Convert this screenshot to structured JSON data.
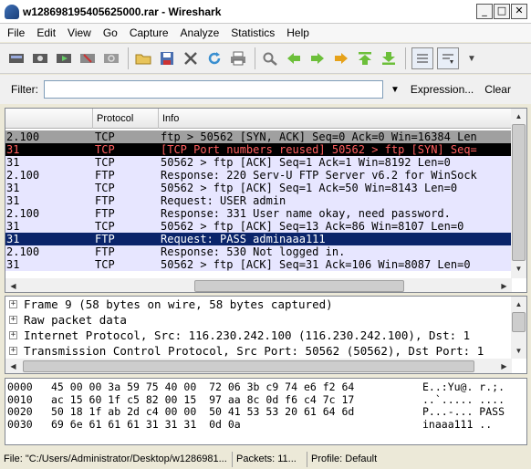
{
  "window": {
    "title": "w128698195405625000.rar - Wireshark",
    "min": "_",
    "max": "□",
    "close": "✕"
  },
  "menu": [
    "File",
    "Edit",
    "View",
    "Go",
    "Capture",
    "Analyze",
    "Statistics",
    "Help"
  ],
  "filter": {
    "label": "Filter:",
    "value": "",
    "expression": "Expression...",
    "clear": "Clear"
  },
  "packet_list": {
    "columns": [
      "",
      "Protocol",
      "Info"
    ],
    "rows": [
      {
        "c1": "2.100",
        "proto": "TCP",
        "info": "ftp > 50562 [SYN, ACK] Seq=0 Ack=0 Win=16384 Len",
        "bg": "#a0a0a0",
        "fg": "#000000"
      },
      {
        "c1": "31",
        "proto": "TCP",
        "info": "[TCP Port numbers reused] 50562 > ftp [SYN] Seq=",
        "bg": "#000000",
        "fg": "#ff5f5f"
      },
      {
        "c1": "31",
        "proto": "TCP",
        "info": "50562 > ftp [ACK] Seq=1 Ack=1 Win=8192 Len=0",
        "bg": "#e7e6ff",
        "fg": "#000000"
      },
      {
        "c1": "2.100",
        "proto": "FTP",
        "info": "Response: 220 Serv-U FTP Server v6.2 for WinSock",
        "bg": "#e7e6ff",
        "fg": "#000000"
      },
      {
        "c1": "31",
        "proto": "TCP",
        "info": "50562 > ftp [ACK] Seq=1 Ack=50 Win=8143 Len=0",
        "bg": "#e7e6ff",
        "fg": "#000000"
      },
      {
        "c1": "31",
        "proto": "FTP",
        "info": "Request: USER admin",
        "bg": "#e7e6ff",
        "fg": "#000000"
      },
      {
        "c1": "2.100",
        "proto": "FTP",
        "info": "Response: 331 User name okay, need password.",
        "bg": "#e7e6ff",
        "fg": "#000000"
      },
      {
        "c1": "31",
        "proto": "TCP",
        "info": "50562 > ftp [ACK] Seq=13 Ack=86 Win=8107 Len=0",
        "bg": "#e7e6ff",
        "fg": "#000000"
      },
      {
        "c1": "31",
        "proto": "FTP",
        "info": "Request: PASS adminaaa111",
        "bg": "#0a246a",
        "fg": "#ffffff"
      },
      {
        "c1": "2.100",
        "proto": "FTP",
        "info": "Response: 530 Not logged in.",
        "bg": "#e7e6ff",
        "fg": "#000000"
      },
      {
        "c1": "31",
        "proto": "TCP",
        "info": "50562 > ftp [ACK] Seq=31 Ack=106 Win=8087 Len=0",
        "bg": "#e7e6ff",
        "fg": "#000000"
      }
    ]
  },
  "details": [
    "Frame 9 (58 bytes on wire, 58 bytes captured)",
    "Raw packet data",
    "Internet Protocol, Src: 116.230.242.100 (116.230.242.100), Dst: 1",
    "Transmission Control Protocol, Src Port: 50562 (50562), Dst Port: 1"
  ],
  "hex": [
    {
      "off": "0000",
      "bytes": "45 00 00 3a 59 75 40 00  72 06 3b c9 74 e6 f2 64",
      "ascii": "E..:Yu@. r.;."
    },
    {
      "off": "0010",
      "bytes": "ac 15 60 1f c5 82 00 15  97 aa 8c 0d f6 c4 7c 17",
      "ascii": "..`..... ...."
    },
    {
      "off": "0020",
      "bytes": "50 18 1f ab 2d c4 00 00  50 41 53 53 20 61 64 6d",
      "ascii": "P...-... PASS"
    },
    {
      "off": "0030",
      "bytes": "69 6e 61 61 61 31 31 31  0d 0a",
      "ascii": "inaaa111 .."
    }
  ],
  "status": {
    "file": "File: \"C:/Users/Administrator/Desktop/w1286981...",
    "packets": "Packets: 11...",
    "profile": "Profile: Default"
  }
}
